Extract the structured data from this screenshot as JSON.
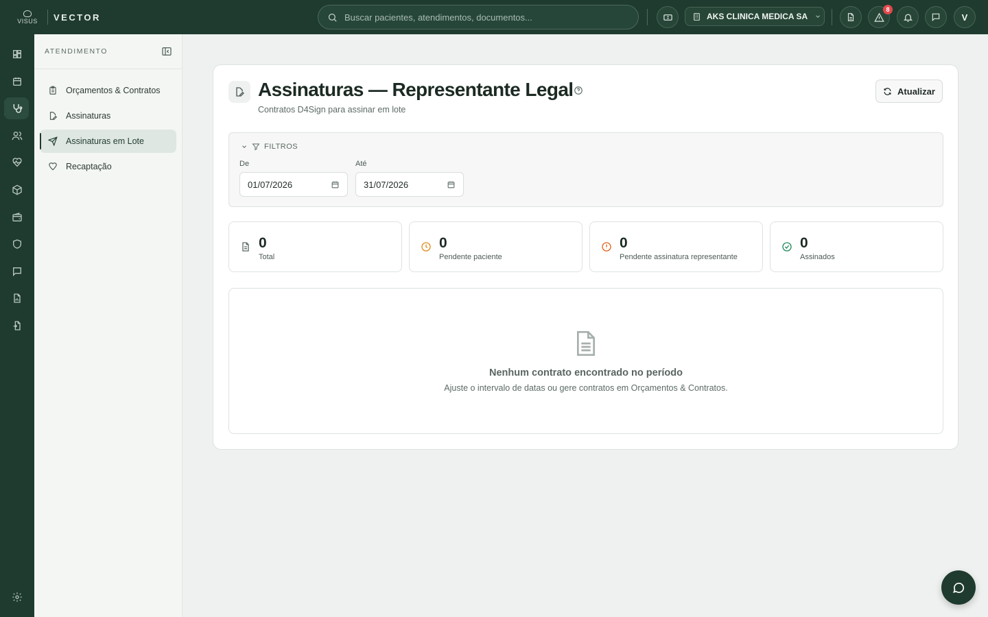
{
  "header": {
    "logo_text": "VISUS",
    "brand": "VECTOR",
    "search_placeholder": "Buscar pacientes, atendimentos, documentos...",
    "organization": "AKS CLINICA MEDICA SA",
    "alerts_count": "8",
    "avatar_initial": "V"
  },
  "rail": {
    "icons": [
      "dashboard-icon",
      "calendar-icon",
      "stethoscope-icon",
      "users-icon",
      "heart-pulse-icon",
      "package-icon",
      "wallet-icon",
      "shield-icon",
      "message-icon",
      "report-icon",
      "document-transfer-icon",
      "gear-icon"
    ],
    "active": "stethoscope-icon"
  },
  "sidebar": {
    "section_title": "ATENDIMENTO",
    "items": [
      {
        "label": "Orçamentos & Contratos",
        "icon": "clipboard-icon"
      },
      {
        "label": "Assinaturas",
        "icon": "file-edit-icon"
      },
      {
        "label": "Assinaturas em Lote",
        "icon": "send-icon",
        "active": true
      },
      {
        "label": "Recaptação",
        "icon": "heart-icon"
      }
    ]
  },
  "page": {
    "title": "Assinaturas — Representante Legal",
    "subtitle": "Contratos D4Sign para assinar em lote",
    "refresh_label": "Atualizar"
  },
  "filters": {
    "title": "FILTROS",
    "from_label": "De",
    "from_value": "01/07/2026",
    "to_label": "Até",
    "to_value": "31/07/2026"
  },
  "stats": [
    {
      "value": "0",
      "label": "Total",
      "icon": "file-text-icon",
      "color": "#5c6b63"
    },
    {
      "value": "0",
      "label": "Pendente paciente",
      "icon": "clock-icon",
      "color": "#e08a1e"
    },
    {
      "value": "0",
      "label": "Pendente assinatura representante",
      "icon": "alert-circle-icon",
      "color": "#e0641e"
    },
    {
      "value": "0",
      "label": "Assinados",
      "icon": "check-circle-icon",
      "color": "#1f8a5a"
    }
  ],
  "empty_state": {
    "title": "Nenhum contrato encontrado no período",
    "description": "Ajuste o intervalo de datas ou gere contratos em Orçamentos & Contratos."
  },
  "colors": {
    "brand_dark": "#1f3b2f",
    "alert_badge": "#e5484d"
  }
}
